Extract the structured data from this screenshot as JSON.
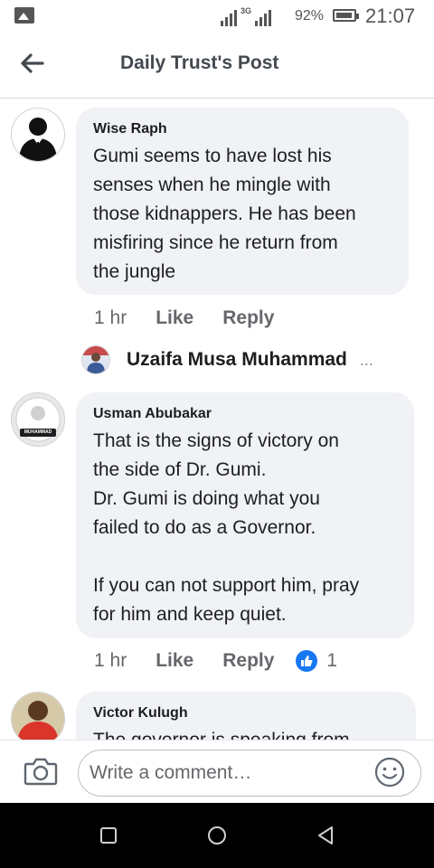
{
  "status_bar": {
    "network": "3G",
    "battery_percent": "92%",
    "time": "21:07"
  },
  "header": {
    "title": "Daily Trust's Post",
    "back_icon": "arrow-left-icon"
  },
  "comments": [
    {
      "author": "Wise Raph",
      "text": "Gumi seems to have lost his\nsenses when he mingle with\nthose kidnappers. He has been\nmisfiring since he return from\nthe jungle",
      "time": "1 hr",
      "like_label": "Like",
      "reply_label": "Reply"
    },
    {
      "author": "Usman Abubakar",
      "text": "That is the signs of victory on\nthe side of Dr. Gumi.\nDr. Gumi is doing what you\nfailed to do as a Governor.\n\nIf you can not support him, pray\nfor him and keep quiet.",
      "time": "1 hr",
      "like_label": "Like",
      "reply_label": "Reply",
      "reaction_count": "1",
      "avatar_caption": "MUHAMMAD"
    },
    {
      "author": "Victor Kulugh",
      "text": "The governor is speaking from"
    }
  ],
  "reply_preview": {
    "name": "Uzaifa Musa Muhammad",
    "more": "..."
  },
  "composer": {
    "placeholder": "Write a comment…",
    "camera_icon": "camera-icon",
    "emoji_icon": "smiley-icon"
  },
  "colors": {
    "bubble": "#f0f2f5",
    "like_badge": "#1877f2",
    "secondary_text": "#65676b"
  }
}
